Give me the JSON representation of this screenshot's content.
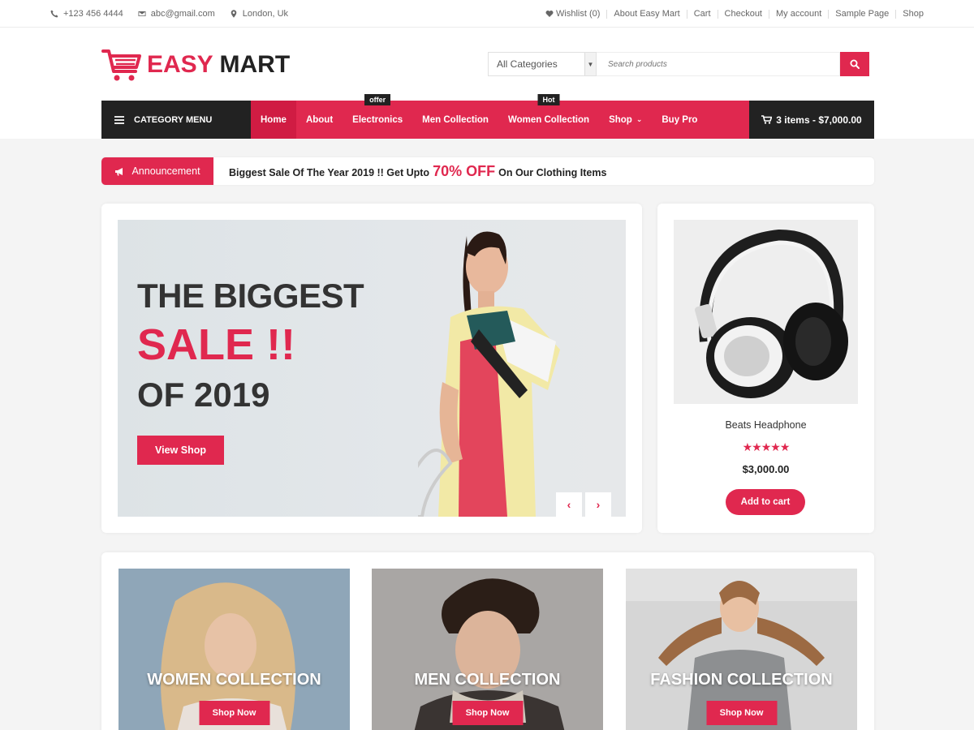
{
  "topbar": {
    "phone": "+123 456 4444",
    "email": "abc@gmail.com",
    "location": "London, Uk",
    "links": [
      "Wishlist (0)",
      "About Easy Mart",
      "Cart",
      "Checkout",
      "My account",
      "Sample Page",
      "Shop"
    ]
  },
  "header": {
    "logo_part1": "EASY",
    "logo_part2": "MART",
    "category_select": "All Categories",
    "search_placeholder": "Search products"
  },
  "nav": {
    "category_menu": "CATEGORY MENU",
    "items": [
      {
        "label": "Home",
        "active": true,
        "badge": ""
      },
      {
        "label": "About",
        "active": false,
        "badge": ""
      },
      {
        "label": "Electronics",
        "active": false,
        "badge": "offer"
      },
      {
        "label": "Men Collection",
        "active": false,
        "badge": ""
      },
      {
        "label": "Women Collection",
        "active": false,
        "badge": "Hot"
      },
      {
        "label": "Shop",
        "active": false,
        "badge": "",
        "dropdown": true
      },
      {
        "label": "Buy Pro",
        "active": false,
        "badge": ""
      }
    ],
    "cart": "3 items - $7,000.00"
  },
  "announcement": {
    "tag": "Announcement",
    "text_before": "Biggest Sale Of The Year 2019 !! Get Upto",
    "highlight": "70% OFF",
    "text_after": "On Our Clothing Items"
  },
  "slider": {
    "line1": "THE BIGGEST",
    "line2": "SALE !!",
    "line3": "OF 2019",
    "button": "View Shop",
    "prev": "‹",
    "next": "›"
  },
  "product": {
    "name": "Beats Headphone",
    "rating": 5,
    "stars": "★★★★★",
    "price": "$3,000.00",
    "button": "Add to cart"
  },
  "collections": [
    {
      "title": "WOMEN COLLECTION",
      "button": "Shop Now"
    },
    {
      "title": "MEN COLLECTION",
      "button": "Shop Now"
    },
    {
      "title": "FASHION COLLECTION",
      "button": "Shop Now"
    }
  ],
  "colors": {
    "accent": "#e0284f",
    "dark": "#222222",
    "background": "#f4f4f4"
  }
}
